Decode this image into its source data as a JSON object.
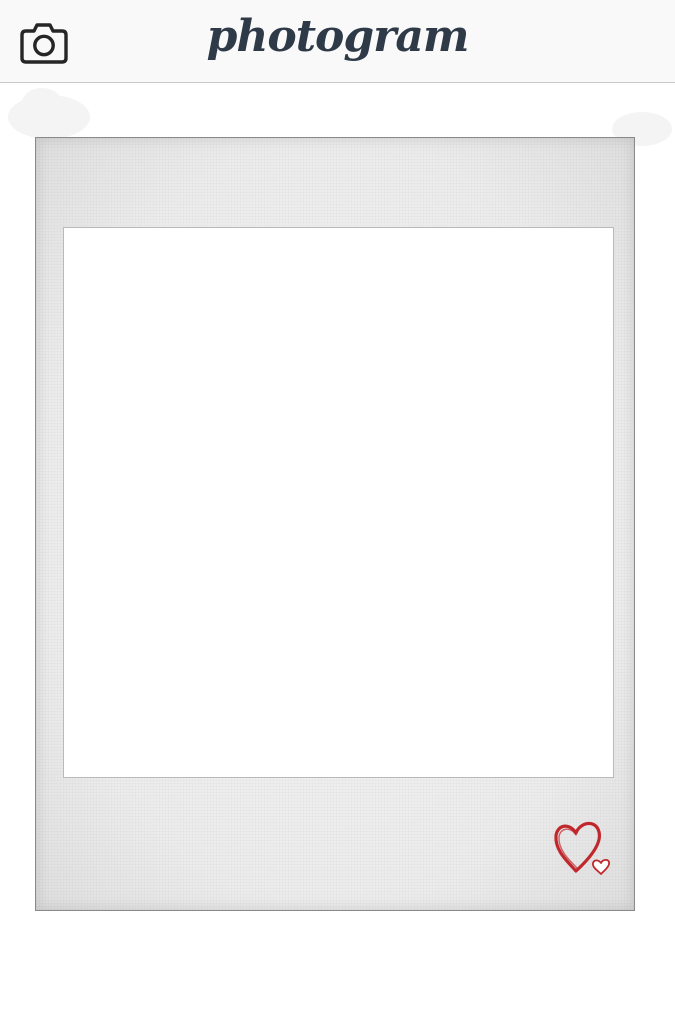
{
  "header": {
    "brand_title": "photogram",
    "camera_icon": "camera-icon"
  },
  "post": {
    "photo": "",
    "like_icon": "heart-icon",
    "like_icon_small": "small-heart-icon"
  },
  "colors": {
    "brand_text": "#2e3a48",
    "topbar_bg": "#f9f9f9",
    "frame_bg": "#ececec",
    "heart": "#c0282d"
  }
}
